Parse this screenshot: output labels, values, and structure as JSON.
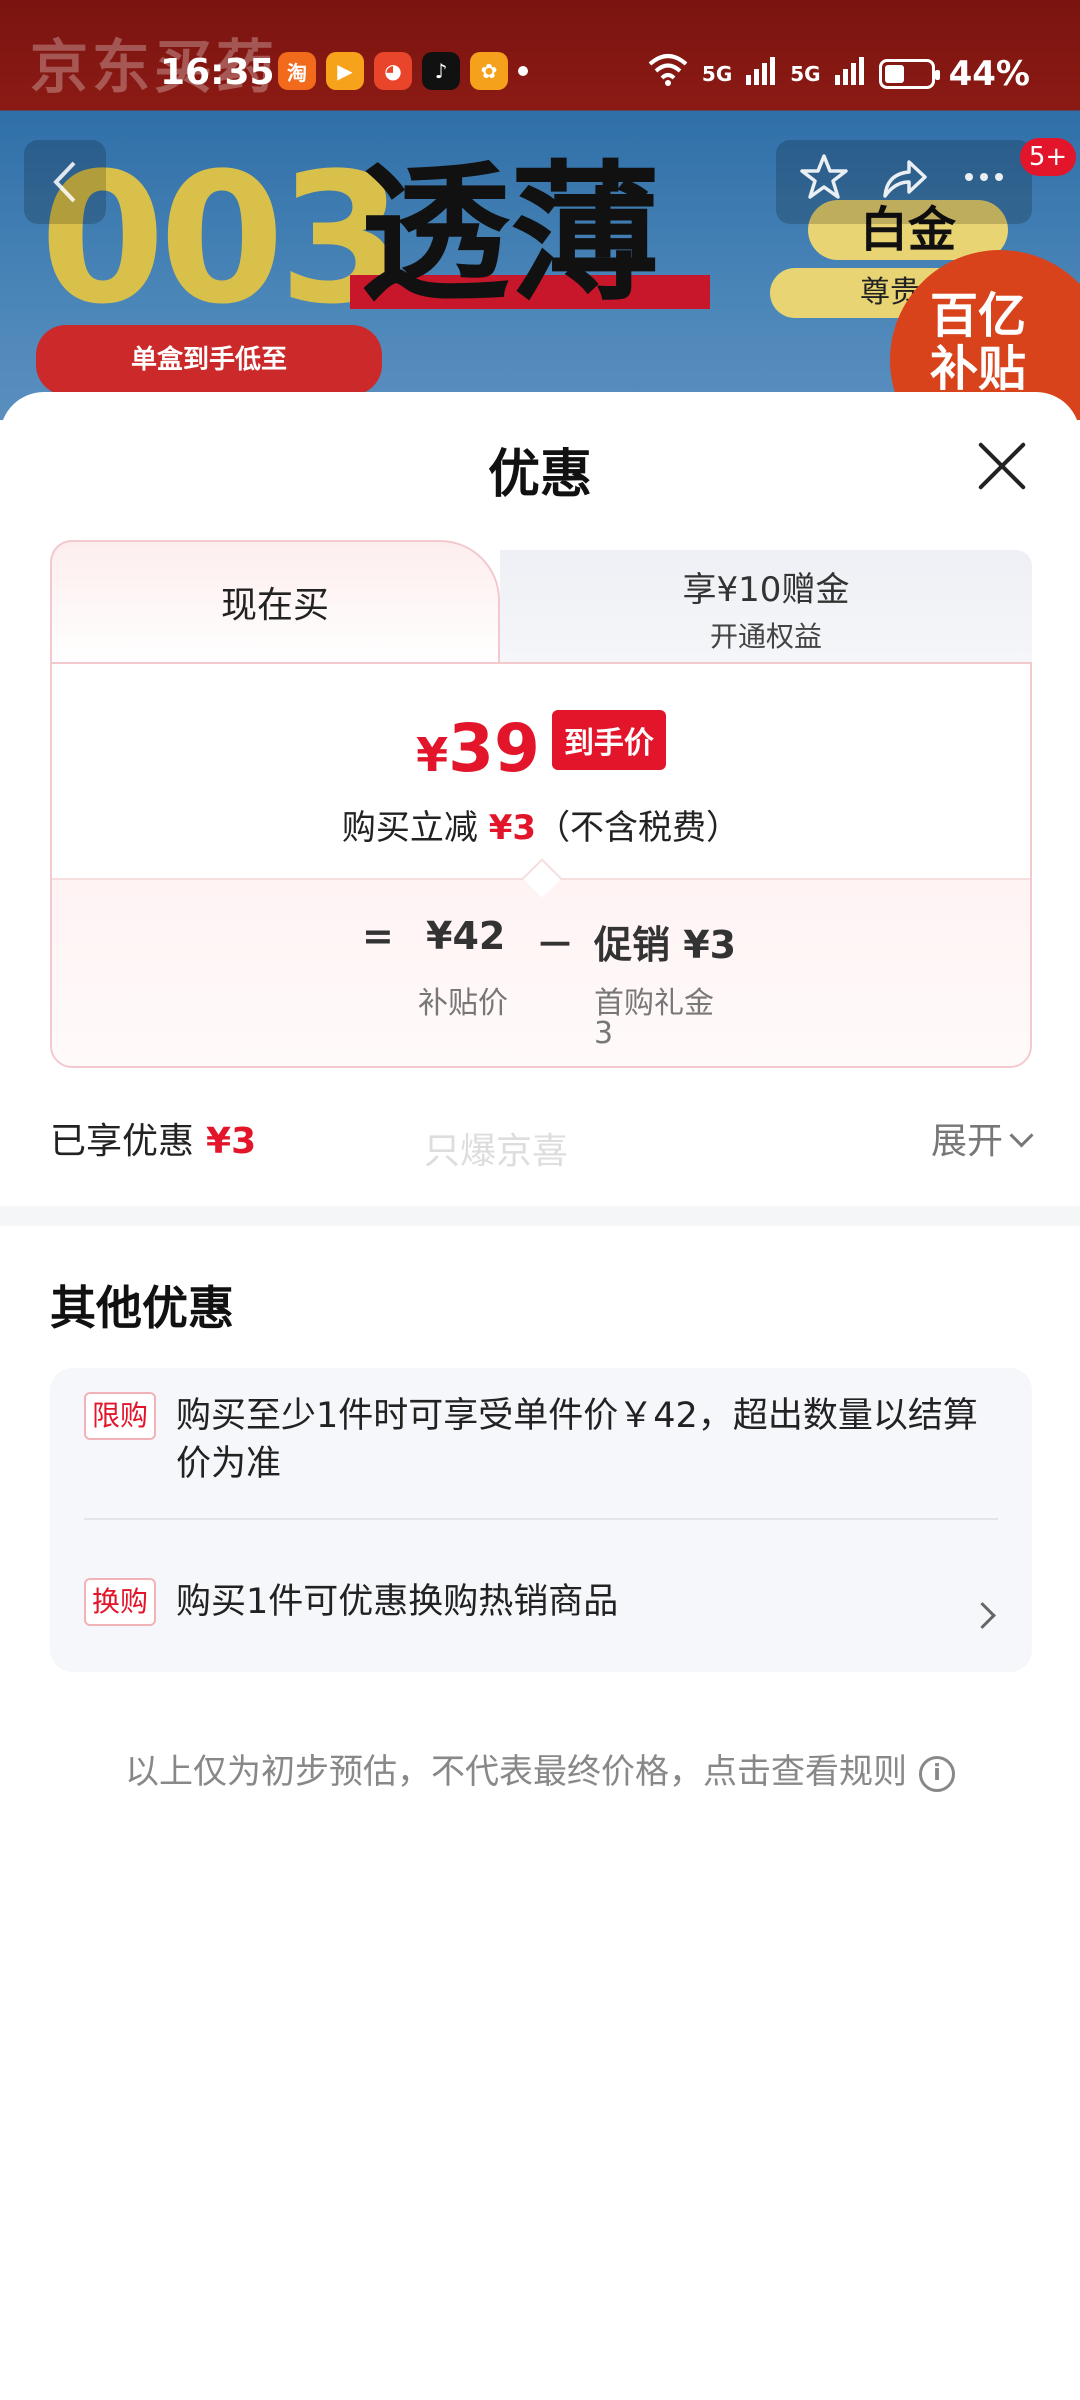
{
  "status_bar": {
    "time": "16:35",
    "signal1": "5G",
    "signal2": "5G",
    "battery": "44%",
    "battery_level": 0.44,
    "apps": [
      "淘",
      "",
      "",
      "",
      ""
    ]
  },
  "banner": {
    "brand": "京东买药",
    "big_text": "003",
    "promo_word": "透薄",
    "pill_text": "单盒到手低至",
    "gold_tag": "白金",
    "gold_sub": "尊贵",
    "subsidy": "百亿\n补贴",
    "cart_badge": "5+"
  },
  "sheet": {
    "title": "优惠",
    "tab_now": "现在买",
    "tab_member_line1": "享¥10赠金",
    "tab_member_line2": "开通权益",
    "price_symbol": "¥",
    "price_value": "39",
    "price_tag": "到手价",
    "desc_prefix": "购买立减",
    "desc_amount": "¥3",
    "desc_suffix": "（不含税费）",
    "calc": {
      "equals": "=",
      "subsidy_price": "¥42",
      "subsidy_label": "补贴价",
      "minus": "－",
      "promo_label": "促销 ¥3",
      "promo_sub": "首购礼金",
      "promo_sub2": "3"
    },
    "enjoyed_label": "已享优惠",
    "enjoyed_amount": "¥3",
    "ghost_text": "只爆京喜",
    "expand_label": "展开"
  },
  "other": {
    "title": "其他优惠",
    "offers": [
      {
        "tag": "限购",
        "text": "购买至少1件时可享受单件价￥42，超出数量以结算价为准"
      },
      {
        "tag": "换购",
        "text": "购买1件可优惠换购热销商品"
      }
    ]
  },
  "footnote": "以上仅为初步预估，不代表最终价格，点击查看规则",
  "colors": {
    "accent": "#e2152b"
  }
}
